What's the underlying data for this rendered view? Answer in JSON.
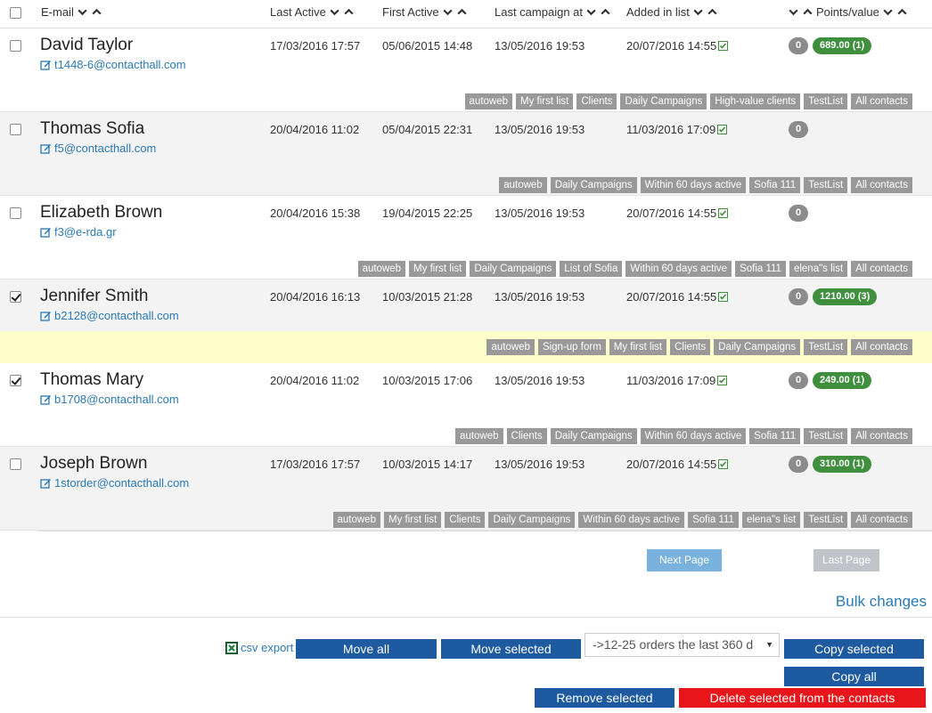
{
  "header": {
    "email": "E-mail",
    "last_active": "Last Active",
    "first_active": "First Active",
    "last_campaign": "Last campaign at",
    "added": "Added in list",
    "points": "Points/value"
  },
  "contacts": [
    {
      "name": "David Taylor",
      "email": "t1448-6@contacthall.com",
      "last_active": "17/03/2016 17:57",
      "first_active": "05/06/2015 14:48",
      "last_campaign": "13/05/2016 19:53",
      "added": "20/07/2016 14:55",
      "points": "0",
      "value": "689.00 (1)",
      "checked": false,
      "lists": [
        "autoweb",
        "My first list",
        "Clients",
        "Daily Campaigns",
        "High-value clients",
        "TestList",
        "All contacts"
      ]
    },
    {
      "name": "Thomas Sofia",
      "email": "f5@contacthall.com",
      "last_active": "20/04/2016 11:02",
      "first_active": "05/04/2015 22:31",
      "last_campaign": "13/05/2016 19:53",
      "added": "11/03/2016 17:09",
      "points": "0",
      "value": "",
      "checked": false,
      "lists": [
        "autoweb",
        "Daily Campaigns",
        "Within 60 days active",
        "Sofia 111",
        "TestList",
        "All contacts"
      ]
    },
    {
      "name": "Elizabeth Brown",
      "email": "f3@e-rda.gr",
      "last_active": "20/04/2016 15:38",
      "first_active": "19/04/2015 22:25",
      "last_campaign": "13/05/2016 19:53",
      "added": "20/07/2016 14:55",
      "points": "0",
      "value": "",
      "checked": false,
      "lists": [
        "autoweb",
        "My first list",
        "Daily Campaigns",
        "List of Sofia",
        "Within 60 days active",
        "Sofia 111",
        "elena\"s list",
        "All contacts"
      ]
    },
    {
      "name": "Jennifer Smith",
      "email": "b2128@contacthall.com",
      "last_active": "20/04/2016 16:13",
      "first_active": "10/03/2015 21:28",
      "last_campaign": "13/05/2016 19:53",
      "added": "20/07/2016 14:55",
      "points": "0",
      "value": "1210.00 (3)",
      "checked": true,
      "lists": [
        "autoweb",
        "Sign-up form",
        "My first list",
        "Clients",
        "Daily Campaigns",
        "TestList",
        "All contacts"
      ]
    },
    {
      "name": "Thomas Mary",
      "email": "b1708@contacthall.com",
      "last_active": "20/04/2016 11:02",
      "first_active": "10/03/2015 17:06",
      "last_campaign": "13/05/2016 19:53",
      "added": "11/03/2016 17:09",
      "points": "0",
      "value": "249.00 (1)",
      "checked": true,
      "lists": [
        "autoweb",
        "Clients",
        "Daily Campaigns",
        "Within 60 days active",
        "Sofia 111",
        "TestList",
        "All contacts"
      ]
    },
    {
      "name": "Joseph Brown",
      "email": "1storder@contacthall.com",
      "last_active": "17/03/2016 17:57",
      "first_active": "10/03/2015 14:17",
      "last_campaign": "13/05/2016 19:53",
      "added": "20/07/2016 14:55",
      "points": "0",
      "value": "310.00 (1)",
      "checked": false,
      "lists": [
        "autoweb",
        "My first list",
        "Clients",
        "Daily Campaigns",
        "Within 60 days active",
        "Sofia 111",
        "elena\"s list",
        "TestList",
        "All contacts"
      ]
    }
  ],
  "pagination": {
    "next": "Next Page >>",
    "last": "Last Page >"
  },
  "bulk": {
    "title": "Bulk changes",
    "csv_export": "csv export",
    "move_all": "Move all",
    "move_selected": "Move selected",
    "select_value": "->12-25 orders the last 360 d",
    "copy_selected": "Copy selected",
    "copy_all": "Copy all",
    "remove_selected": "Remove selected",
    "delete_selected": "Delete selected from the contacts"
  },
  "colors": {
    "link": "#2a7ab8",
    "tag": "#999999",
    "badge_green": "#3f8f3f",
    "button_blue": "#1e5aa0",
    "button_red": "#e8161b",
    "highlight": "#ffffcc"
  }
}
